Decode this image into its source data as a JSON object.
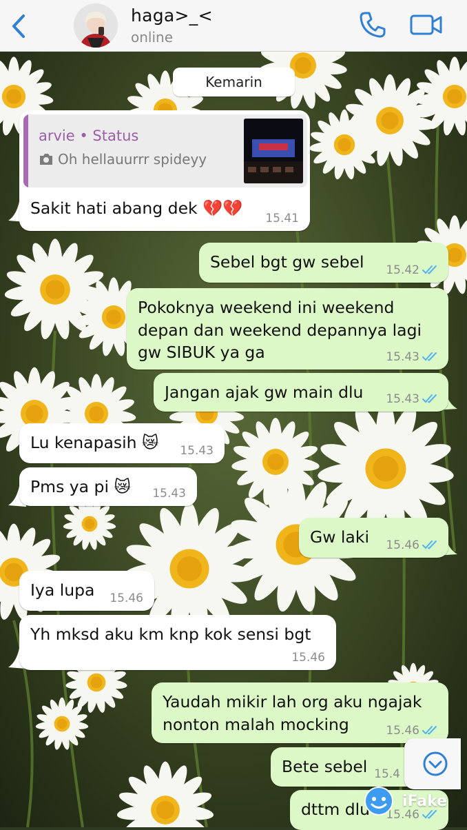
{
  "header": {
    "contact_name": "haga>_<",
    "status": "online"
  },
  "date_separator": "Kemarin",
  "quoted_status": {
    "author": "arvie • Status",
    "text": "Oh hellauurrr spideyy"
  },
  "messages": [
    {
      "dir": "in",
      "text": "Sakit hati abang dek 💔💔",
      "time": "15.41"
    },
    {
      "dir": "out",
      "text": "Sebel bgt gw sebel",
      "time": "15.42"
    },
    {
      "dir": "out",
      "line1": "Pokoknya weekend ini weekend",
      "line2": "depan dan weekend depannya lagi",
      "line3": "gw SIBUK ya ga",
      "time": "15.43"
    },
    {
      "dir": "out",
      "text": "Jangan ajak gw main dlu",
      "time": "15.43"
    },
    {
      "dir": "in",
      "text": "Lu kenapasih 😿",
      "time": "15.43"
    },
    {
      "dir": "in",
      "text": "Pms ya pi 😿",
      "time": "15.43"
    },
    {
      "dir": "out",
      "text": "Gw laki",
      "time": "15.46"
    },
    {
      "dir": "in",
      "text": "Iya lupa",
      "time": "15.46"
    },
    {
      "dir": "in",
      "text": "Yh mksd aku km knp kok sensi bgt",
      "time": "15.46"
    },
    {
      "dir": "out",
      "line1": "Yaudah mikir lah org aku ngajak",
      "line2": "nonton malah mocking",
      "time": "15.46"
    },
    {
      "dir": "out",
      "text": "Bete sebel",
      "time": "15.4"
    },
    {
      "dir": "out",
      "text": "dttm dlu",
      "time": "15.46"
    }
  ],
  "watermark": "iFake",
  "colors": {
    "incoming_bubble": "#ffffff",
    "outgoing_bubble": "#dcf8c6",
    "accent_blue": "#2f7fd6",
    "read_ticks": "#4fb3f6",
    "status_author": "#9a5ea6"
  },
  "icons": [
    "back-chevron-icon",
    "phone-icon",
    "video-camera-icon",
    "camera-icon",
    "double-check-icon",
    "chevron-down-icon"
  ]
}
